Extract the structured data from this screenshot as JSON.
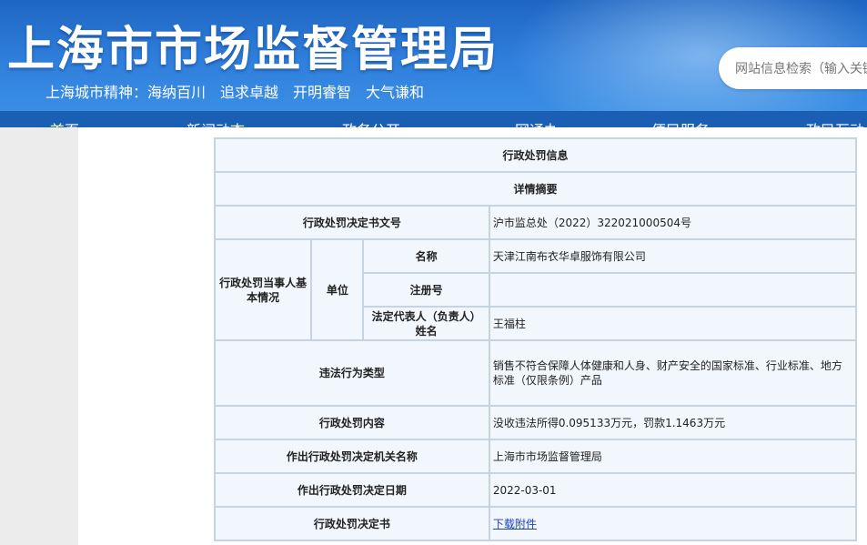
{
  "header": {
    "title": "上海市市场监督管理局",
    "slogan": [
      "上海城市精神：海纳百川",
      "追求卓越",
      "开明睿智",
      "大气谦和"
    ]
  },
  "search": {
    "placeholder": "网站信息检索（输入关键字）"
  },
  "nav": {
    "items": [
      "首页",
      "新闻动态",
      "政务公开",
      "网通办",
      "便民服务",
      "政民互动"
    ]
  },
  "detail": {
    "section_title": "行政处罚信息",
    "summary_title": "详情摘要",
    "doc_no_label": "行政处罚决定书文号",
    "doc_no": "沪市监总处（2022）322021000504号",
    "party_label": "行政处罚当事人基本情况",
    "unit_label": "单位",
    "name_label": "名称",
    "name": "天津江南布衣华卓服饰有限公司",
    "reg_no_label": "注册号",
    "reg_no": "",
    "legal_rep_label": "法定代表人（负责人）姓名",
    "legal_rep": "王福柱",
    "violation_type_label": "违法行为类型",
    "violation_type": "销售不符合保障人体健康和人身、财产安全的国家标准、行业标准、地方标准（仅限条例）产品",
    "penalty_content_label": "行政处罚内容",
    "penalty_content": "没收违法所得0.095133万元，罚款1.1463万元",
    "authority_label": "作出行政处罚决定机关名称",
    "authority": "上海市市场监督管理局",
    "date_label": "作出行政处罚决定日期",
    "date": "2022-03-01",
    "decision_label": "行政处罚决定书",
    "download_link": "下载附件"
  }
}
